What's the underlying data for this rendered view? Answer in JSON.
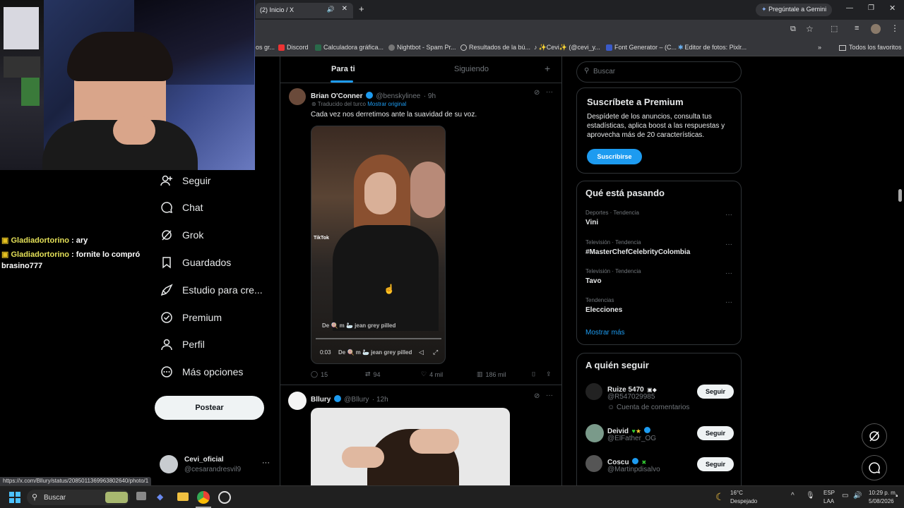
{
  "browser": {
    "tab_title": "(2) Inicio / X",
    "gemini_label": "Pregúntale a Gemini",
    "bookmarks": [
      "Discord",
      "Calculadora gráfica...",
      "Nightbot - Spam Pr...",
      "Resultados de la bú...",
      "✨Cevi✨ (@cevi_y...",
      "Font Generator – (C...",
      "Editor de fotos: Pixlr..."
    ],
    "bookmarks_prefix": "os gr...",
    "all_favorites": "Todos los favoritos",
    "status_url": "https://x.com/Bllury/status/2085011369963802640/photo/1"
  },
  "chat": {
    "lines": [
      {
        "user": "Gladiadortorino",
        "text": " : ary"
      },
      {
        "user": "Gladiadortorino",
        "text": " : fornite lo compró"
      }
    ],
    "wrap": "brasino777"
  },
  "nav": {
    "items": [
      {
        "label": "Seguir",
        "icon": "person-add-icon"
      },
      {
        "label": "Chat",
        "icon": "chat-icon"
      },
      {
        "label": "Grok",
        "icon": "grok-icon"
      },
      {
        "label": "Guardados",
        "icon": "bookmark-icon"
      },
      {
        "label": "Estudio para cre...",
        "icon": "rocket-icon"
      },
      {
        "label": "Premium",
        "icon": "verified-icon"
      },
      {
        "label": "Perfil",
        "icon": "person-icon"
      },
      {
        "label": "Más opciones",
        "icon": "more-circle-icon"
      }
    ],
    "post_button": "Postear",
    "account": {
      "name": "Cevi_oficial",
      "handle": "@cesarandresvil9"
    }
  },
  "feed": {
    "tabs": [
      "Para ti",
      "Siguiendo"
    ],
    "tweet1": {
      "name": "Brian O'Conner",
      "handle": "@benskylinee",
      "time": "· 9h",
      "translated": "Traducido del turco",
      "show_original": "Mostrar original",
      "text": "Cada vez nos derretimos ante la suavidad de su voz.",
      "video_time": "0:03",
      "caption": "De 🍭 m 🦢 jean grey pilled",
      "caption2": "De 🍭 m 🦢 jean grey pilled",
      "tiktok": "TikTok",
      "replies": "15",
      "reposts": "94",
      "likes": "4 mil",
      "views": "186 mil"
    },
    "tweet2": {
      "name": "Bllury",
      "handle": "@Bllury",
      "time": "· 12h"
    }
  },
  "right": {
    "search_placeholder": "Buscar",
    "premium": {
      "title": "Suscríbete a Premium",
      "body": "Despídete de los anuncios, consulta tus estadísticas, aplica boost a las respuestas y aprovecha más de 20 características.",
      "button": "Suscribirse"
    },
    "trends_title": "Qué está pasando",
    "trends": [
      {
        "category": "Deportes · Tendencia",
        "title": "Vini"
      },
      {
        "category": "Televisión · Tendencia",
        "title": "#MasterChefCelebrityColombia"
      },
      {
        "category": "Televisión · Tendencia",
        "title": "Tavo"
      },
      {
        "category": "Tendencias",
        "title": "Elecciones"
      }
    ],
    "show_more": "Mostrar más",
    "follow_title": "A quién seguir",
    "suggestions": [
      {
        "name": "Ruize 5470",
        "handle": "@R547029985",
        "note": "Cuenta de comentarios"
      },
      {
        "name": "Deivid",
        "handle": "@ElFather_OG"
      },
      {
        "name": "Coscu",
        "handle": "@Martinpdisalvo"
      }
    ],
    "follow_label": "Seguir"
  },
  "taskbar": {
    "search": "Buscar",
    "weather_temp": "16°C",
    "weather_desc": "Despejado",
    "lang1": "ESP",
    "lang2": "LAA",
    "time": "10:29 p. m.",
    "date": "5/08/2026"
  },
  "colors": {
    "accent": "#1d9bf0",
    "bg": "#000000",
    "border": "#2f3336",
    "chat_user": "#e4e058"
  }
}
